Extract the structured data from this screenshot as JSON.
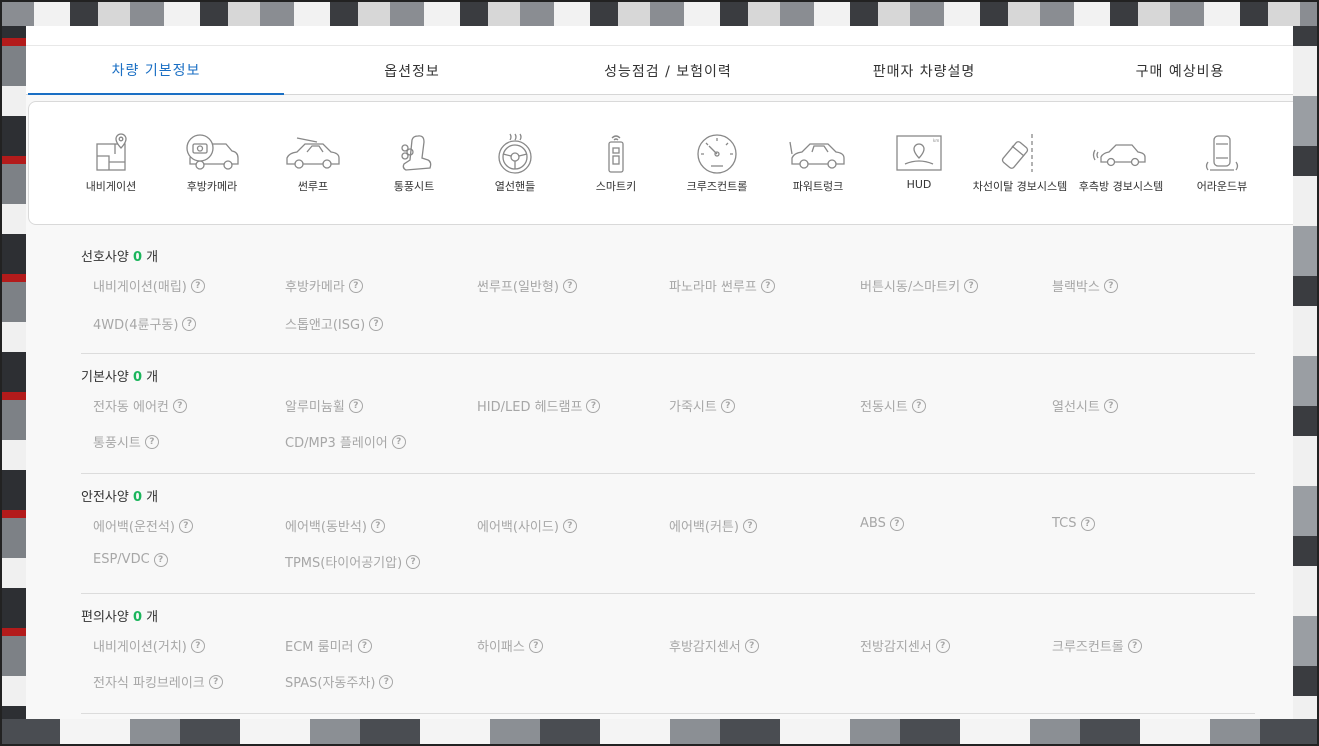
{
  "tabs": [
    "차량 기본정보",
    "옵션정보",
    "성능점검 / 보험이력",
    "판매자 차량설명",
    "구매 예상비용"
  ],
  "active_tab": 0,
  "options_icons": [
    {
      "label": "내비게이션",
      "icon": "navigation-icon"
    },
    {
      "label": "후방카메라",
      "icon": "rear-camera-icon"
    },
    {
      "label": "썬루프",
      "icon": "sunroof-icon"
    },
    {
      "label": "통풍시트",
      "icon": "ventilated-seat-icon"
    },
    {
      "label": "열선핸들",
      "icon": "heated-steering-icon"
    },
    {
      "label": "스마트키",
      "icon": "smart-key-icon"
    },
    {
      "label": "크루즈컨트롤",
      "icon": "cruise-control-icon"
    },
    {
      "label": "파워트렁크",
      "icon": "power-trunk-icon"
    },
    {
      "label": "HUD",
      "icon": "hud-icon"
    },
    {
      "label": "차선이탈 경보시스템",
      "icon": "lane-departure-icon"
    },
    {
      "label": "후측방 경보시스템",
      "icon": "blind-spot-icon"
    },
    {
      "label": "어라운드뷰",
      "icon": "around-view-icon"
    }
  ],
  "sections": [
    {
      "title": "선호사양",
      "count": "0",
      "unit": "개",
      "items": [
        "내비게이션(매립)",
        "후방카메라",
        "썬루프(일반형)",
        "파노라마 썬루프",
        "버튼시동/스마트키",
        "블랙박스",
        "4WD(4륜구동)",
        "스톱앤고(ISG)"
      ]
    },
    {
      "title": "기본사양",
      "count": "0",
      "unit": "개",
      "items": [
        "전자동 에어컨",
        "알루미늄휠",
        "HID/LED 헤드램프",
        "가죽시트",
        "전동시트",
        "열선시트",
        "통풍시트",
        "CD/MP3 플레이어"
      ]
    },
    {
      "title": "안전사양",
      "count": "0",
      "unit": "개",
      "items": [
        "에어백(운전석)",
        "에어백(동반석)",
        "에어백(사이드)",
        "에어백(커튼)",
        "ABS",
        "TCS",
        "ESP/VDC",
        "TPMS(타이어공기압)"
      ]
    },
    {
      "title": "편의사양",
      "count": "0",
      "unit": "개",
      "items": [
        "내비게이션(거치)",
        "ECM 룸미러",
        "하이패스",
        "후방감지센서",
        "전방감지센서",
        "크루즈컨트롤",
        "전자식 파킹브레이크",
        "SPAS(자동주차)"
      ]
    }
  ],
  "help_glyph": "?",
  "colors": {
    "accent": "#1a6fc4",
    "count": "#1bb55c",
    "muted": "#a7a7a7"
  }
}
